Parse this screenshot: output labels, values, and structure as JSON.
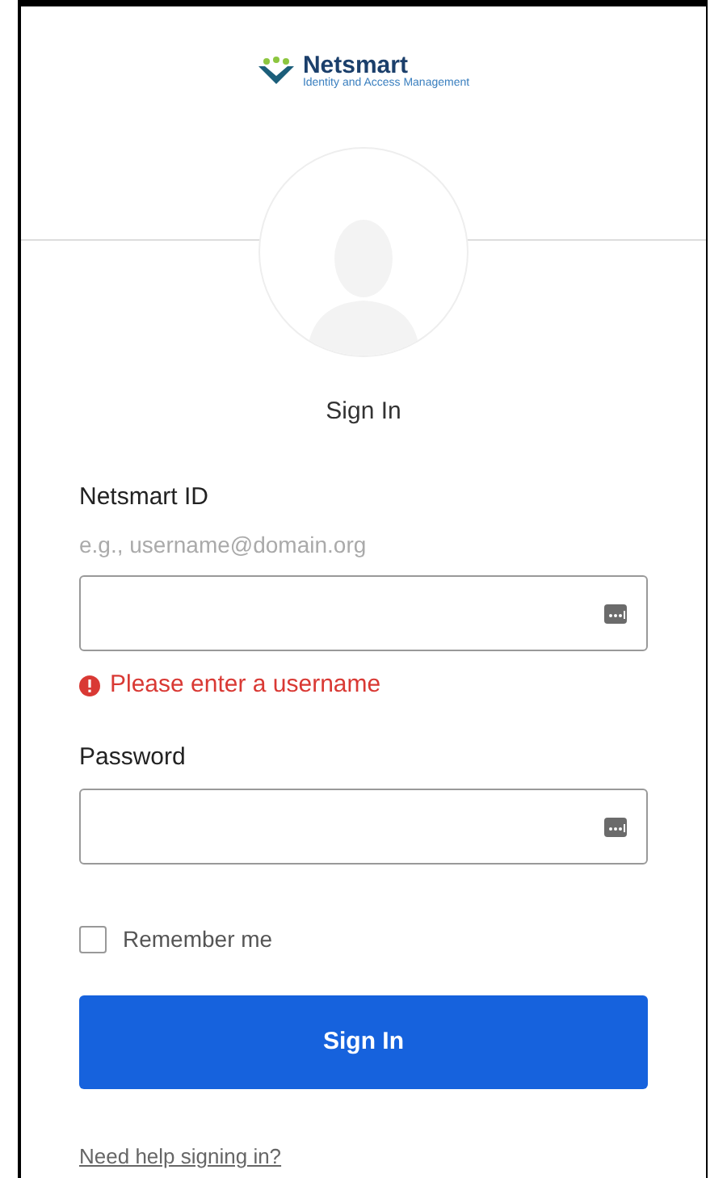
{
  "logo": {
    "name": "Netsmart",
    "tagline": "Identity and Access Management"
  },
  "title": "Sign In",
  "fields": [
    {
      "label": "Netsmart ID",
      "hint": "e.g., username@domain.org",
      "error": "Please enter a username"
    },
    {
      "label": "Password"
    }
  ],
  "remember": {
    "label": "Remember me",
    "checked": false
  },
  "button": "Sign In",
  "help_link": "Need help signing in?"
}
